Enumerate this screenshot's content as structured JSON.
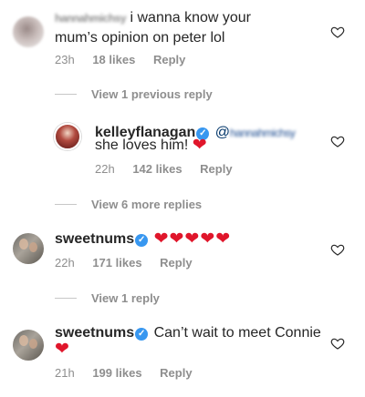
{
  "comments": [
    {
      "username": "hannahmichsy",
      "text": "i wanna know your",
      "text_line2": "mum’s opinion on peter lol",
      "time": "23h",
      "likes": "18 likes",
      "reply": "Reply"
    },
    {
      "username": "kelleyflanagan",
      "mention_at": "@",
      "mention": "hannahmichsy",
      "text": "she loves him!",
      "emoji": "❤",
      "time": "22h",
      "likes": "142 likes",
      "reply": "Reply"
    },
    {
      "username": "sweetnums",
      "text": "",
      "emoji": "❤❤❤❤❤",
      "time": "22h",
      "likes": "171 likes",
      "reply": "Reply"
    },
    {
      "username": "sweetnums",
      "text": "Can’t wait to meet Connie",
      "emoji": "❤",
      "time": "21h",
      "likes": "199 likes",
      "reply": "Reply"
    }
  ],
  "view_previous": "View 1 previous reply",
  "view_more": "View 6 more replies",
  "view_reply": "View 1 reply",
  "icons": {
    "heart_outline": "heart-outline-icon",
    "verified": "verified-badge-icon",
    "verified_glyph": "✓"
  },
  "colors": {
    "verified_blue": "#3897f0",
    "meta_gray": "#8e8e8e",
    "heart_red": "#e0162b"
  }
}
